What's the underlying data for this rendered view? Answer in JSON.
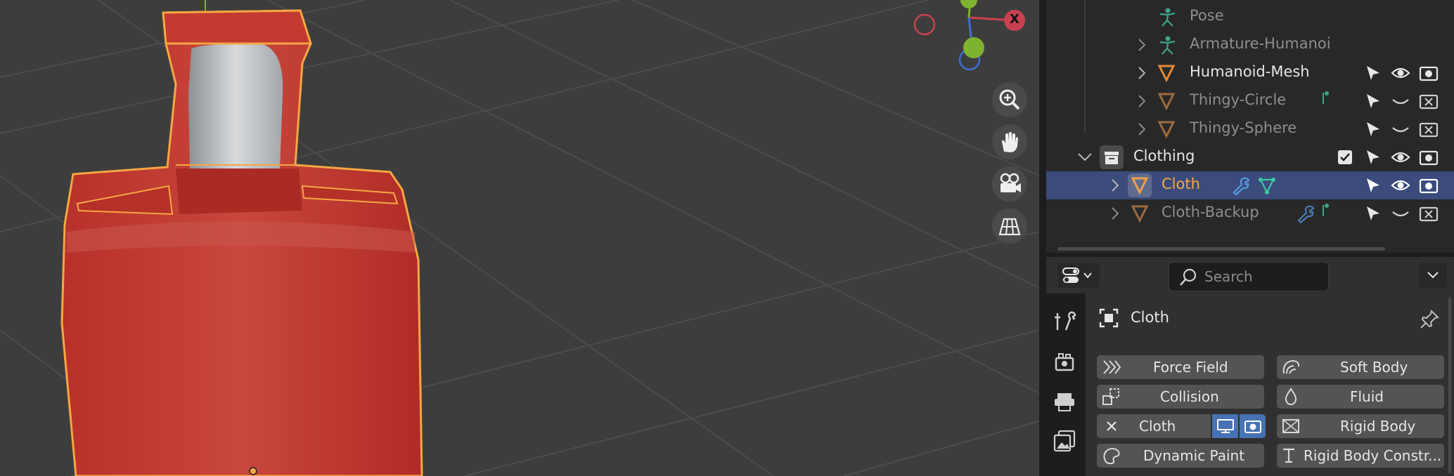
{
  "viewport": {
    "axis_x_label": "X",
    "nav_icons": [
      "zoom-icon",
      "pan-hand-icon",
      "camera-icon",
      "grid-icon"
    ],
    "colors": {
      "cloth": "#c0362c",
      "outline": "#f5a742",
      "x_axis": "#c94150",
      "y_axis": "#7fb32f",
      "z_axis": "#3f6fd1"
    }
  },
  "outliner": {
    "rows": [
      {
        "label": "Pose",
        "icon": "pose-icon",
        "dim": true
      },
      {
        "label": "Armature-Humanoi",
        "icon": "armature-icon",
        "dim": true
      },
      {
        "label": "Humanoid-Mesh",
        "icon": "mesh-icon",
        "dim": false
      },
      {
        "label": "Thingy-Circle",
        "icon": "mesh-icon",
        "dim": true
      },
      {
        "label": "Thingy-Sphere",
        "icon": "mesh-icon",
        "dim": true
      },
      {
        "label": "Clothing",
        "icon": "collection-icon",
        "dim": false
      },
      {
        "label": "Cloth",
        "icon": "mesh-icon",
        "selected": true
      },
      {
        "label": "Cloth-Backup",
        "icon": "mesh-icon",
        "dim": true
      }
    ]
  },
  "properties": {
    "editor_type_icon": "properties-editor-icon",
    "search_placeholder": "Search",
    "object_name": "Cloth",
    "tabs": [
      "tool-icon",
      "render-icon",
      "output-icon",
      "view-layer-icon"
    ],
    "buttons": {
      "force_field": "Force Field",
      "soft_body": "Soft Body",
      "collision": "Collision",
      "fluid": "Fluid",
      "cloth": "Cloth",
      "rigid_body": "Rigid Body",
      "dynamic_paint": "Dynamic Paint",
      "rigid_body_constraint": "Rigid Body Constr..."
    }
  }
}
